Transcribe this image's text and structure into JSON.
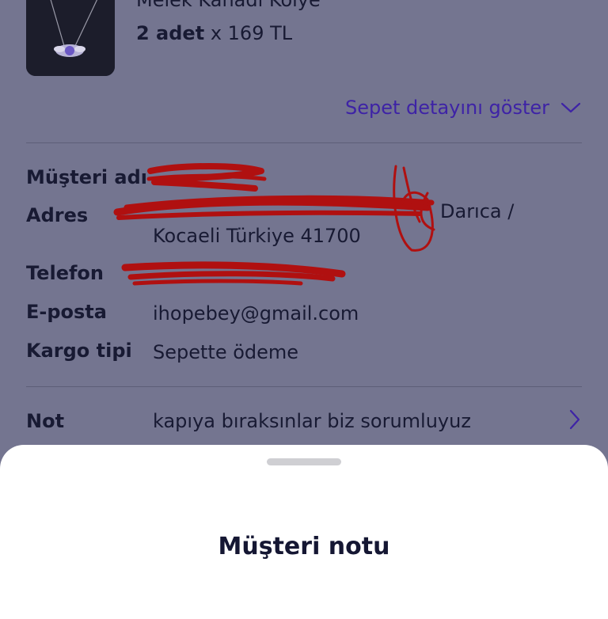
{
  "product": {
    "name": "Melek Kanadı Kolye",
    "quantity": "2 adet",
    "price": "x 169 TL"
  },
  "cart": {
    "show_details": "Sepet detayını göster"
  },
  "customer": {
    "name_label": "Müşteri adı",
    "address_label": "Adres",
    "address_visible_part": "Darıca /",
    "address_line2": "Kocaeli Türkiye 41700",
    "phone_label": "Telefon",
    "email_label": "E-posta",
    "email_value": "ihopebey@gmail.com",
    "shipping_label": "Kargo tipi",
    "shipping_value": "Sepette ödeme"
  },
  "note": {
    "label": "Not",
    "value": "kapıya bıraksınlar biz sorumluyuz"
  },
  "sheet": {
    "title": "Müşteri notu"
  },
  "colors": {
    "link": "#3e23a6",
    "redaction": "#b01010",
    "overlay": "#747590"
  }
}
